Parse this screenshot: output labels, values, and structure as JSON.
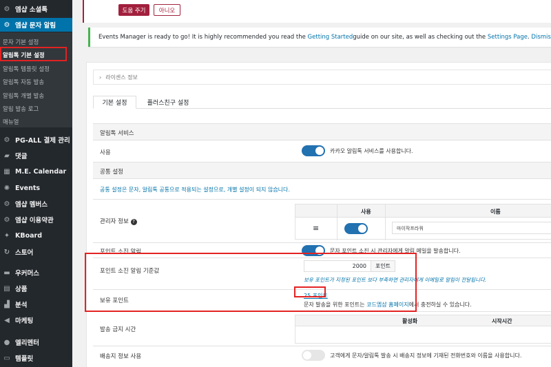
{
  "sidebar": {
    "items": [
      {
        "label": "엠샵 소셜톡",
        "icon": "gear-icon"
      },
      {
        "label": "엠샵 문자 알림",
        "icon": "gear-icon"
      },
      {
        "label": "PG-ALL 결제 관리",
        "icon": "gear-icon"
      },
      {
        "label": "댓글",
        "icon": "comment-icon"
      },
      {
        "label": "M.E. Calendar",
        "icon": "calendar-icon"
      },
      {
        "label": "Events",
        "icon": "events-icon"
      },
      {
        "label": "엠샵 멤버스",
        "icon": "gear-icon"
      },
      {
        "label": "엠샵 이용약관",
        "icon": "gear-icon"
      },
      {
        "label": "KBoard",
        "icon": "kboard-icon"
      },
      {
        "label": "스토어",
        "icon": "store-icon"
      },
      {
        "label": "우커머스",
        "icon": "woocommerce-icon"
      },
      {
        "label": "상품",
        "icon": "archive-icon"
      },
      {
        "label": "분석",
        "icon": "chart-icon"
      },
      {
        "label": "마케팅",
        "icon": "megaphone-icon"
      },
      {
        "label": "엘리멘터",
        "icon": "elementor-icon"
      },
      {
        "label": "템플릿",
        "icon": "folder-icon"
      }
    ],
    "submenu": [
      "문자 기본 설정",
      "알림톡 기본 설정",
      "알림톡 템플릿 설정",
      "알림톡 자동 발송",
      "알림톡 개별 발송",
      "알림 발송 로그",
      "매뉴얼"
    ]
  },
  "top_buttons": {
    "help": "도움 주기",
    "no": "아니오"
  },
  "notice": {
    "text1": "Events Manager is ready to go! It is highly recommended you read the ",
    "link1": "Getting Started",
    "text2": " guide on our site, as well as checking out the ",
    "link2": "Settings Page",
    "text3": ". ",
    "dismiss": "Dismiss"
  },
  "license": "라이센스 정보",
  "tabs": [
    "기본 설정",
    "플러스친구 설정"
  ],
  "sections": {
    "alimtalk": "알림톡 서비스",
    "common": "공통 설정",
    "common_desc": "공통 설정은 문자, 알림톡 공통으로 적용되는 설정으로, 개별 설정이 되지 않습니다."
  },
  "fields": {
    "use_label": "사용",
    "use_desc": "카카오 알림톡 서비스를 사용합니다.",
    "admin_label": "관리자 정보",
    "admin_table": {
      "col_use": "사용",
      "col_name": "이름",
      "name_value": "마이작프라쿼"
    },
    "point_alert_label": "포인트 소진 알림",
    "point_alert_desc": "문자 포인트 소진 시 관리자에게 알림 메일을 발송합니다.",
    "threshold_label": "포인트 소진 알림 기준값",
    "threshold_value": "2000",
    "threshold_unit": "포인트",
    "threshold_desc": "보유 포인트가 지정된 포인트 보다 부족하면 관리자에게 이메일로 알림이 전달됩니다.",
    "holding_label": "보유 포인트",
    "holding_value": "25 포인트",
    "holding_desc1": "문자 발송을 위한 포인트는 ",
    "holding_link": "코드엠샵 홈페이지",
    "holding_desc2": "에서 충전하실 수 있습니다.",
    "ban_label": "발송 금지 시간",
    "ban_col_active": "활성화",
    "ban_col_start": "시작시간",
    "shipping_label": "배송지 정보 사용",
    "shipping_desc": "고객에게 문자/알림톡 발송 시 배송지 정보에 기재된 전화번호와 이름을 사용합니다."
  },
  "colors": {
    "sidebar_bg": "#23282d",
    "active_bg": "#0073aa",
    "accent": "#a2203d",
    "toggle_on": "#2271b1",
    "highlight": "#e32222",
    "notice_border": "#46b450"
  }
}
